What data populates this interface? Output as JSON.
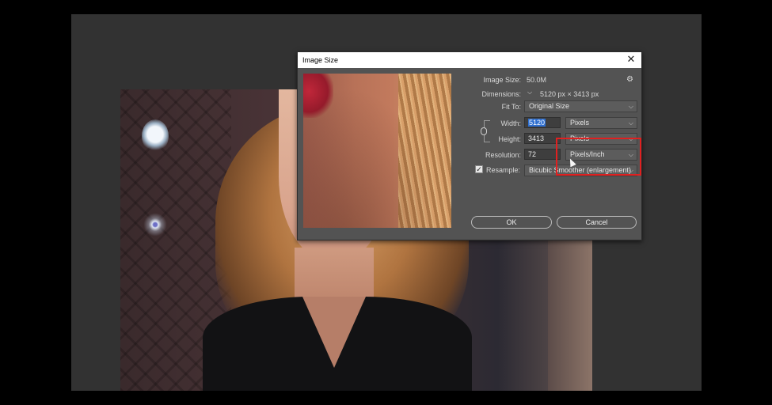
{
  "dialog": {
    "title": "Image Size",
    "image_size_label": "Image Size:",
    "image_size_value": "50.0M",
    "dimensions_label": "Dimensions:",
    "dimensions_value": "5120 px  ×  3413 px",
    "fit_to_label": "Fit To:",
    "fit_to_value": "Original Size",
    "width_label": "Width:",
    "width_value": "5120",
    "width_unit": "Pixels",
    "height_label": "Height:",
    "height_value": "3413",
    "height_unit": "Pixels",
    "resolution_label": "Resolution:",
    "resolution_value": "72",
    "resolution_unit": "Pixels/Inch",
    "resample_label": "Resample:",
    "resample_checked": "✓",
    "resample_value": "Bicubic Smoother (enlargement)",
    "ok_label": "OK",
    "cancel_label": "Cancel",
    "close_glyph": "✕",
    "gear_glyph": "⚙",
    "chevron_glyph": "⌵"
  },
  "annotation": {
    "highlight_color": "#e02020"
  }
}
